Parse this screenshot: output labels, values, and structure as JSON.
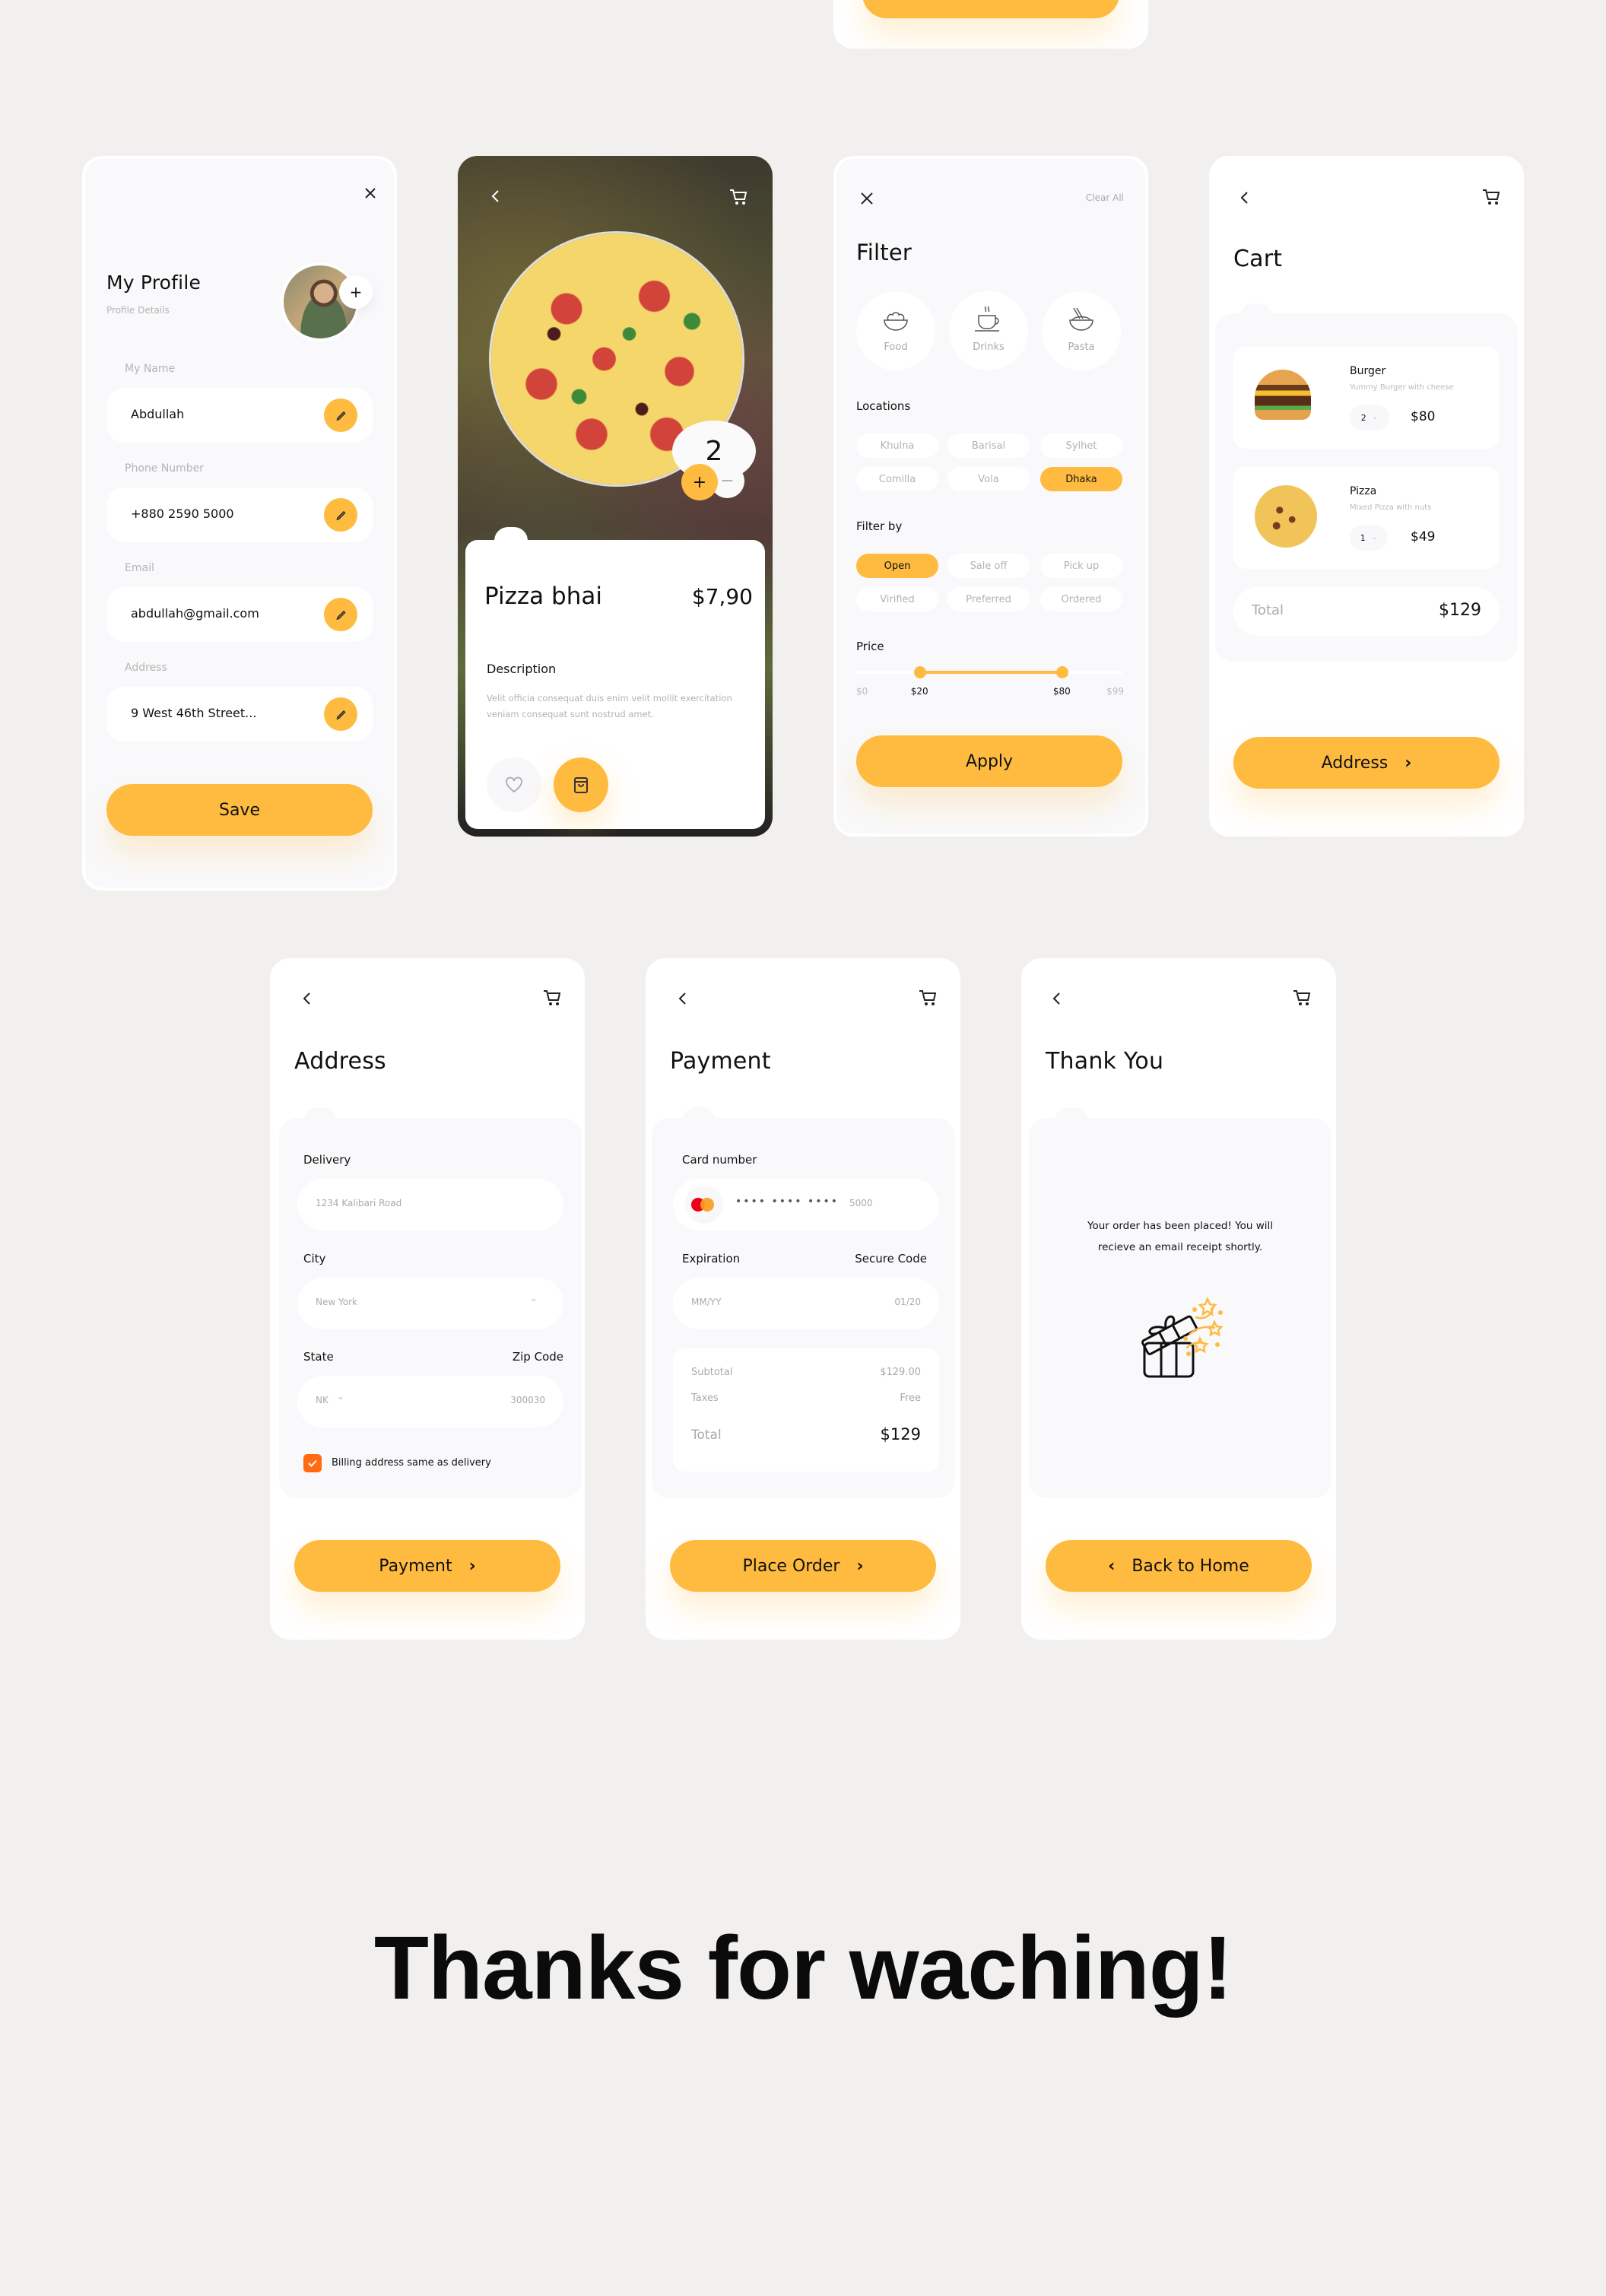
{
  "colors": {
    "accent": "#ffbb40",
    "checkbox": "#ff6a13",
    "background": "#f1f0ee"
  },
  "profile": {
    "title": "My Profile",
    "subtitle": "Profile Details",
    "close_icon": "close-icon",
    "avatar_add": "+",
    "fields": [
      {
        "label": "My Name",
        "value": "Abdullah"
      },
      {
        "label": "Phone Number",
        "value": "+880 2590 5000"
      },
      {
        "label": "Email",
        "value": "abdullah@gmail.com"
      },
      {
        "label": "Address",
        "value": "9 West 46th Street..."
      }
    ],
    "save_label": "Save"
  },
  "product": {
    "name": "Pizza bhai",
    "price": "$7,90",
    "quantity": "2",
    "plus": "+",
    "minus": "−",
    "description_title": "Description",
    "description": "Velit officia consequat duis enim velit mollit exercitation veniam consequat sunt nostrud amet."
  },
  "filter": {
    "title": "Filter",
    "clear_all": "Clear All",
    "categories": [
      "Food",
      "Drinks",
      "Pasta"
    ],
    "locations_title": "Locations",
    "locations": [
      {
        "label": "Khulna",
        "selected": false
      },
      {
        "label": "Barisal",
        "selected": false
      },
      {
        "label": "Sylhet",
        "selected": false
      },
      {
        "label": "Comilla",
        "selected": false
      },
      {
        "label": "Vola",
        "selected": false
      },
      {
        "label": "Dhaka",
        "selected": true
      }
    ],
    "filter_by_title": "Filter by",
    "filter_by": [
      {
        "label": "Open",
        "selected": true
      },
      {
        "label": "Sale off",
        "selected": false
      },
      {
        "label": "Pick up",
        "selected": false
      },
      {
        "label": "Virified",
        "selected": false
      },
      {
        "label": "Preferred",
        "selected": false
      },
      {
        "label": "Ordered",
        "selected": false
      }
    ],
    "price_title": "Price",
    "price_min": "$0",
    "price_low": "$20",
    "price_high": "$80",
    "price_max": "$99",
    "price_range": {
      "min": 0,
      "max": 99,
      "low": 20,
      "high": 80
    },
    "apply_label": "Apply"
  },
  "cart": {
    "title": "Cart",
    "items": [
      {
        "name": "Burger",
        "desc": "Yummy Burger with cheese",
        "qty": "2",
        "price": "$80"
      },
      {
        "name": "Pizza",
        "desc": "Mixed Pizza with nuts",
        "qty": "1",
        "price": "$49"
      }
    ],
    "total_label": "Total",
    "total": "$129",
    "next_label": "Address"
  },
  "address": {
    "title": "Address",
    "delivery_label": "Delivery",
    "delivery_placeholder": "1234 Kalibari Road",
    "city_label": "City",
    "city_value": "New York",
    "state_label": "State",
    "zip_label": "Zip Code",
    "state_value": "NK",
    "zip_value": "300030",
    "billing_checkbox_label": "Billing address same as delivery",
    "billing_checked": true,
    "next_label": "Payment"
  },
  "payment": {
    "title": "Payment",
    "card_label": "Card number",
    "card_masked": "•••• •••• ••••",
    "card_last4": "5000",
    "expiration_label": "Expiration",
    "secure_label": "Secure Code",
    "expiration_placeholder": "MM/YY",
    "expiration_value": "01/20",
    "subtotal_label": "Subtotal",
    "subtotal": "$129.00",
    "taxes_label": "Taxes",
    "taxes": "Free",
    "total_label": "Total",
    "total": "$129",
    "next_label": "Place Order"
  },
  "thankyou": {
    "title": "Thank You",
    "message_line1": "Your order has been placed! You will",
    "message_line2": "recieve an email receipt shortly.",
    "home_label": "Back to Home"
  },
  "footer": {
    "heading": "Thanks for waching!"
  }
}
